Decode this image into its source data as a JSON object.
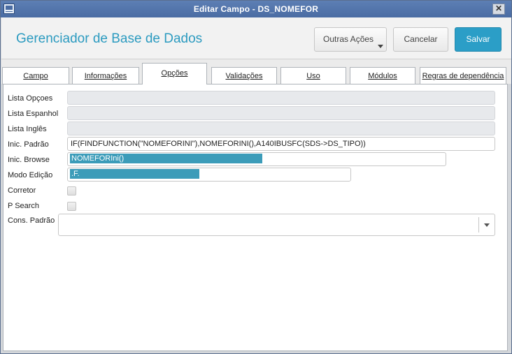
{
  "window": {
    "title": "Editar Campo - DS_NOMEFOR",
    "close_glyph": "✕"
  },
  "header": {
    "app_title": "Gerenciador de Base de Dados",
    "buttons": {
      "outras": "Outras Ações",
      "cancelar": "Cancelar",
      "salvar": "Salvar"
    }
  },
  "tabs": [
    {
      "label": "Campo",
      "active": false
    },
    {
      "label": "Informações",
      "active": false
    },
    {
      "label": "Opções",
      "active": true
    },
    {
      "label": "Validações",
      "active": false
    },
    {
      "label": "Uso",
      "active": false
    },
    {
      "label": "Módulos",
      "active": false
    },
    {
      "label": "Regras de dependência",
      "active": false
    }
  ],
  "form": {
    "lista_opcoes": {
      "label": "Lista Opçoes",
      "value": ""
    },
    "lista_espanhol": {
      "label": "Lista Espanhol",
      "value": ""
    },
    "lista_ingles": {
      "label": "Lista Inglês",
      "value": ""
    },
    "inic_padrao": {
      "label": "Inic. Padrão",
      "value": "IF(FINDFUNCTION(\"NOMEFORINI\"),NOMEFORINI(),A140IBUSFC(SDS->DS_TIPO))"
    },
    "inic_browse": {
      "label": "Inic. Browse",
      "value": "NOMEFORIni()"
    },
    "modo_edicao": {
      "label": "Modo Edição",
      "value": ".F."
    },
    "corretor": {
      "label": "Corretor",
      "checked": false
    },
    "p_search": {
      "label": "P Search",
      "checked": false
    },
    "cons_padrao": {
      "label": "Cons. Padrão",
      "value": ""
    }
  },
  "colors": {
    "accent": "#2b9ec7",
    "selection": "#3c9cb9",
    "titlebar": "#4a6ca3"
  }
}
